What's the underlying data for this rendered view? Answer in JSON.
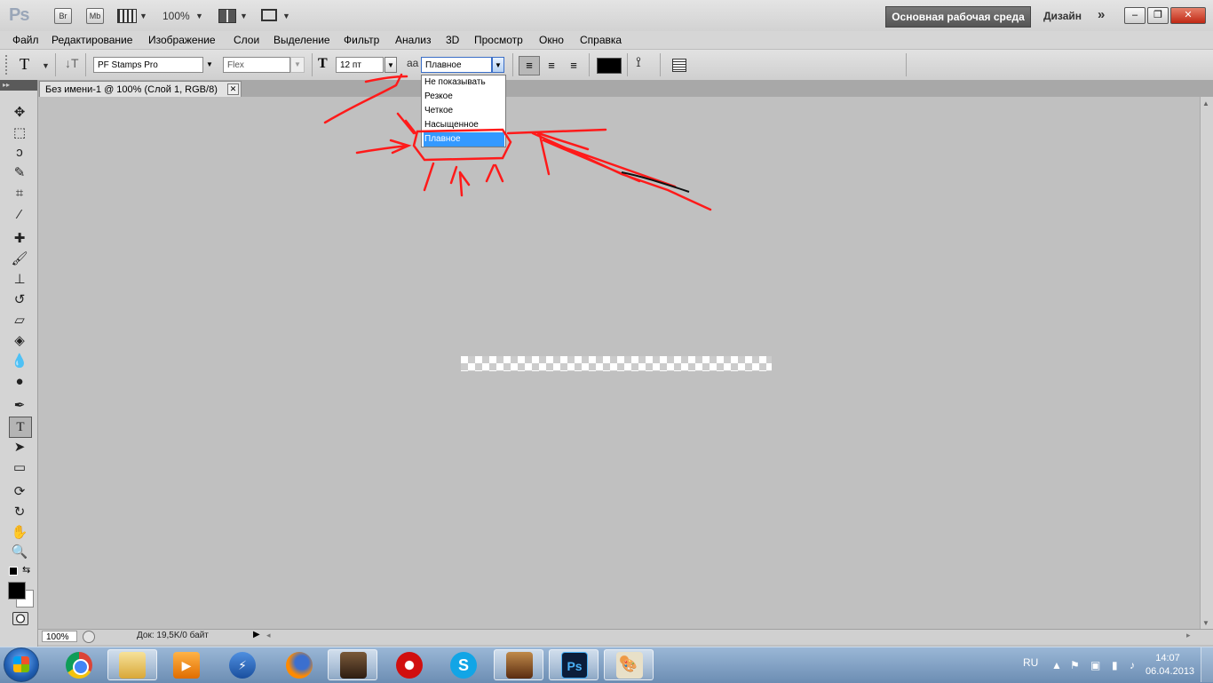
{
  "appbar": {
    "logo": "Ps",
    "bridge_label": "Br",
    "minibridge_label": "Mb",
    "zoom": "100%",
    "workspace_button": "Основная рабочая среда",
    "design_label": "Дизайн",
    "more_label": "»",
    "window_minimize": "–",
    "window_restore": "❐",
    "window_close": "✕"
  },
  "menu": {
    "items": [
      "Файл",
      "Редактирование",
      "Изображение",
      "Слои",
      "Выделение",
      "Фильтр",
      "Анализ",
      "3D",
      "Просмотр",
      "Окно",
      "Справка"
    ]
  },
  "options": {
    "font_family": "PF Stamps Pro",
    "font_style": "Flex",
    "font_size": "12 пт",
    "aa_icon_label": "aa",
    "antialias_selected": "Плавное",
    "antialias_options": [
      "Не показывать",
      "Резкое",
      "Четкое",
      "Насыщенное",
      "Плавное"
    ],
    "antialias_highlighted_index": 4,
    "text_color": "#000000"
  },
  "document": {
    "tab_title": "Без имени-1 @ 100% (Слой 1, RGB/8)",
    "tab_close": "✕"
  },
  "status": {
    "zoom": "100%",
    "doc_info": "Док: 19,5K/0 байт"
  },
  "taskbar": {
    "photoshop_label": "Ps",
    "language": "RU",
    "time": "14:07",
    "date": "06.04.2013"
  },
  "colors": {
    "annotation_red": "#ff1a1a",
    "highlight_blue": "#3399ff",
    "workspace_button_bg": "#5f5f5f"
  }
}
